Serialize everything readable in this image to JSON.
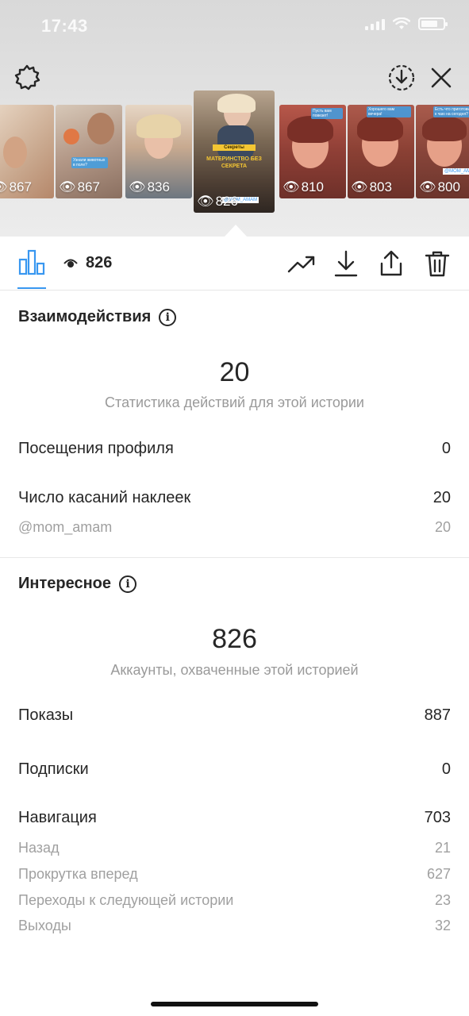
{
  "status_bar": {
    "time": "17:43"
  },
  "stories": [
    {
      "views": "867"
    },
    {
      "views": "867"
    },
    {
      "views": "836"
    },
    {
      "views": "826",
      "active": true
    },
    {
      "views": "810"
    },
    {
      "views": "803"
    },
    {
      "views": "800"
    }
  ],
  "story_stickers": {
    "s2": "Узнали животных в поле?",
    "s4_top": "Секреты",
    "s4_main": "МАТЕРИНСТВО БЕЗ СЕКРЕТА",
    "s4_tag": "@MOM_AMAM",
    "s5": "Пусть вам повезет!",
    "s6": "Хорошего вам вечера!",
    "s7": "Есть что приготовить к чаю на сегодня?",
    "s7_tag": "@MOM_AMAM"
  },
  "toolbar": {
    "views": "826"
  },
  "interactions": {
    "title": "Взаимодействия",
    "total": "20",
    "caption": "Статистика действий для этой истории",
    "rows": [
      {
        "label": "Посещения профиля",
        "value": "0"
      },
      {
        "label": "Число касаний наклеек",
        "value": "20"
      }
    ],
    "sub_rows": [
      {
        "label": "@mom_amam",
        "value": "20"
      }
    ]
  },
  "discovery": {
    "title": "Интересное",
    "total": "826",
    "caption": "Аккаунты, охваченные этой историей",
    "rows": [
      {
        "label": "Показы",
        "value": "887"
      },
      {
        "label": "Подписки",
        "value": "0"
      },
      {
        "label": "Навигация",
        "value": "703"
      }
    ],
    "sub_rows": [
      {
        "label": "Назад",
        "value": "21"
      },
      {
        "label": "Прокрутка вперед",
        "value": "627"
      },
      {
        "label": "Переходы к следующей истории",
        "value": "23"
      },
      {
        "label": "Выходы",
        "value": "32"
      }
    ]
  },
  "colors": {
    "accent": "#3897f0",
    "text": "#262626",
    "muted": "#9a9a9a"
  }
}
